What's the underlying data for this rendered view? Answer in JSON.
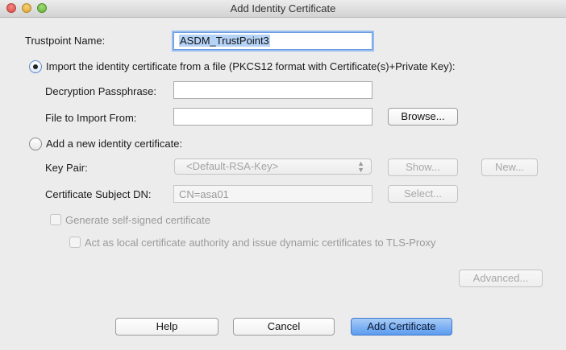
{
  "window": {
    "title": "Add Identity Certificate"
  },
  "trustpoint": {
    "label": "Trustpoint Name:",
    "value": "ASDM_TrustPoint3"
  },
  "import_option": {
    "label": "Import the identity certificate from a file (PKCS12 format with Certificate(s)+Private Key):",
    "selected": true,
    "passphrase_label": "Decryption Passphrase:",
    "passphrase_value": "",
    "file_label": "File to Import From:",
    "file_value": "",
    "browse_label": "Browse..."
  },
  "new_option": {
    "label": "Add a new identity certificate:",
    "selected": false,
    "keypair_label": "Key Pair:",
    "keypair_value": "<Default-RSA-Key>",
    "show_label": "Show...",
    "new_label": "New...",
    "subject_label": "Certificate Subject DN:",
    "subject_value": "CN=asa01",
    "select_label": "Select...",
    "self_signed_label": "Generate self-signed certificate",
    "self_signed_checked": false,
    "local_ca_label": "Act as local certificate authority and issue dynamic certificates to TLS-Proxy",
    "local_ca_checked": false,
    "advanced_label": "Advanced..."
  },
  "footer": {
    "help_label": "Help",
    "cancel_label": "Cancel",
    "add_label": "Add Certificate"
  },
  "colors": {
    "default_button": "#5b9bef",
    "focus_ring": "#97bdf0",
    "window_bg": "#ececec"
  }
}
